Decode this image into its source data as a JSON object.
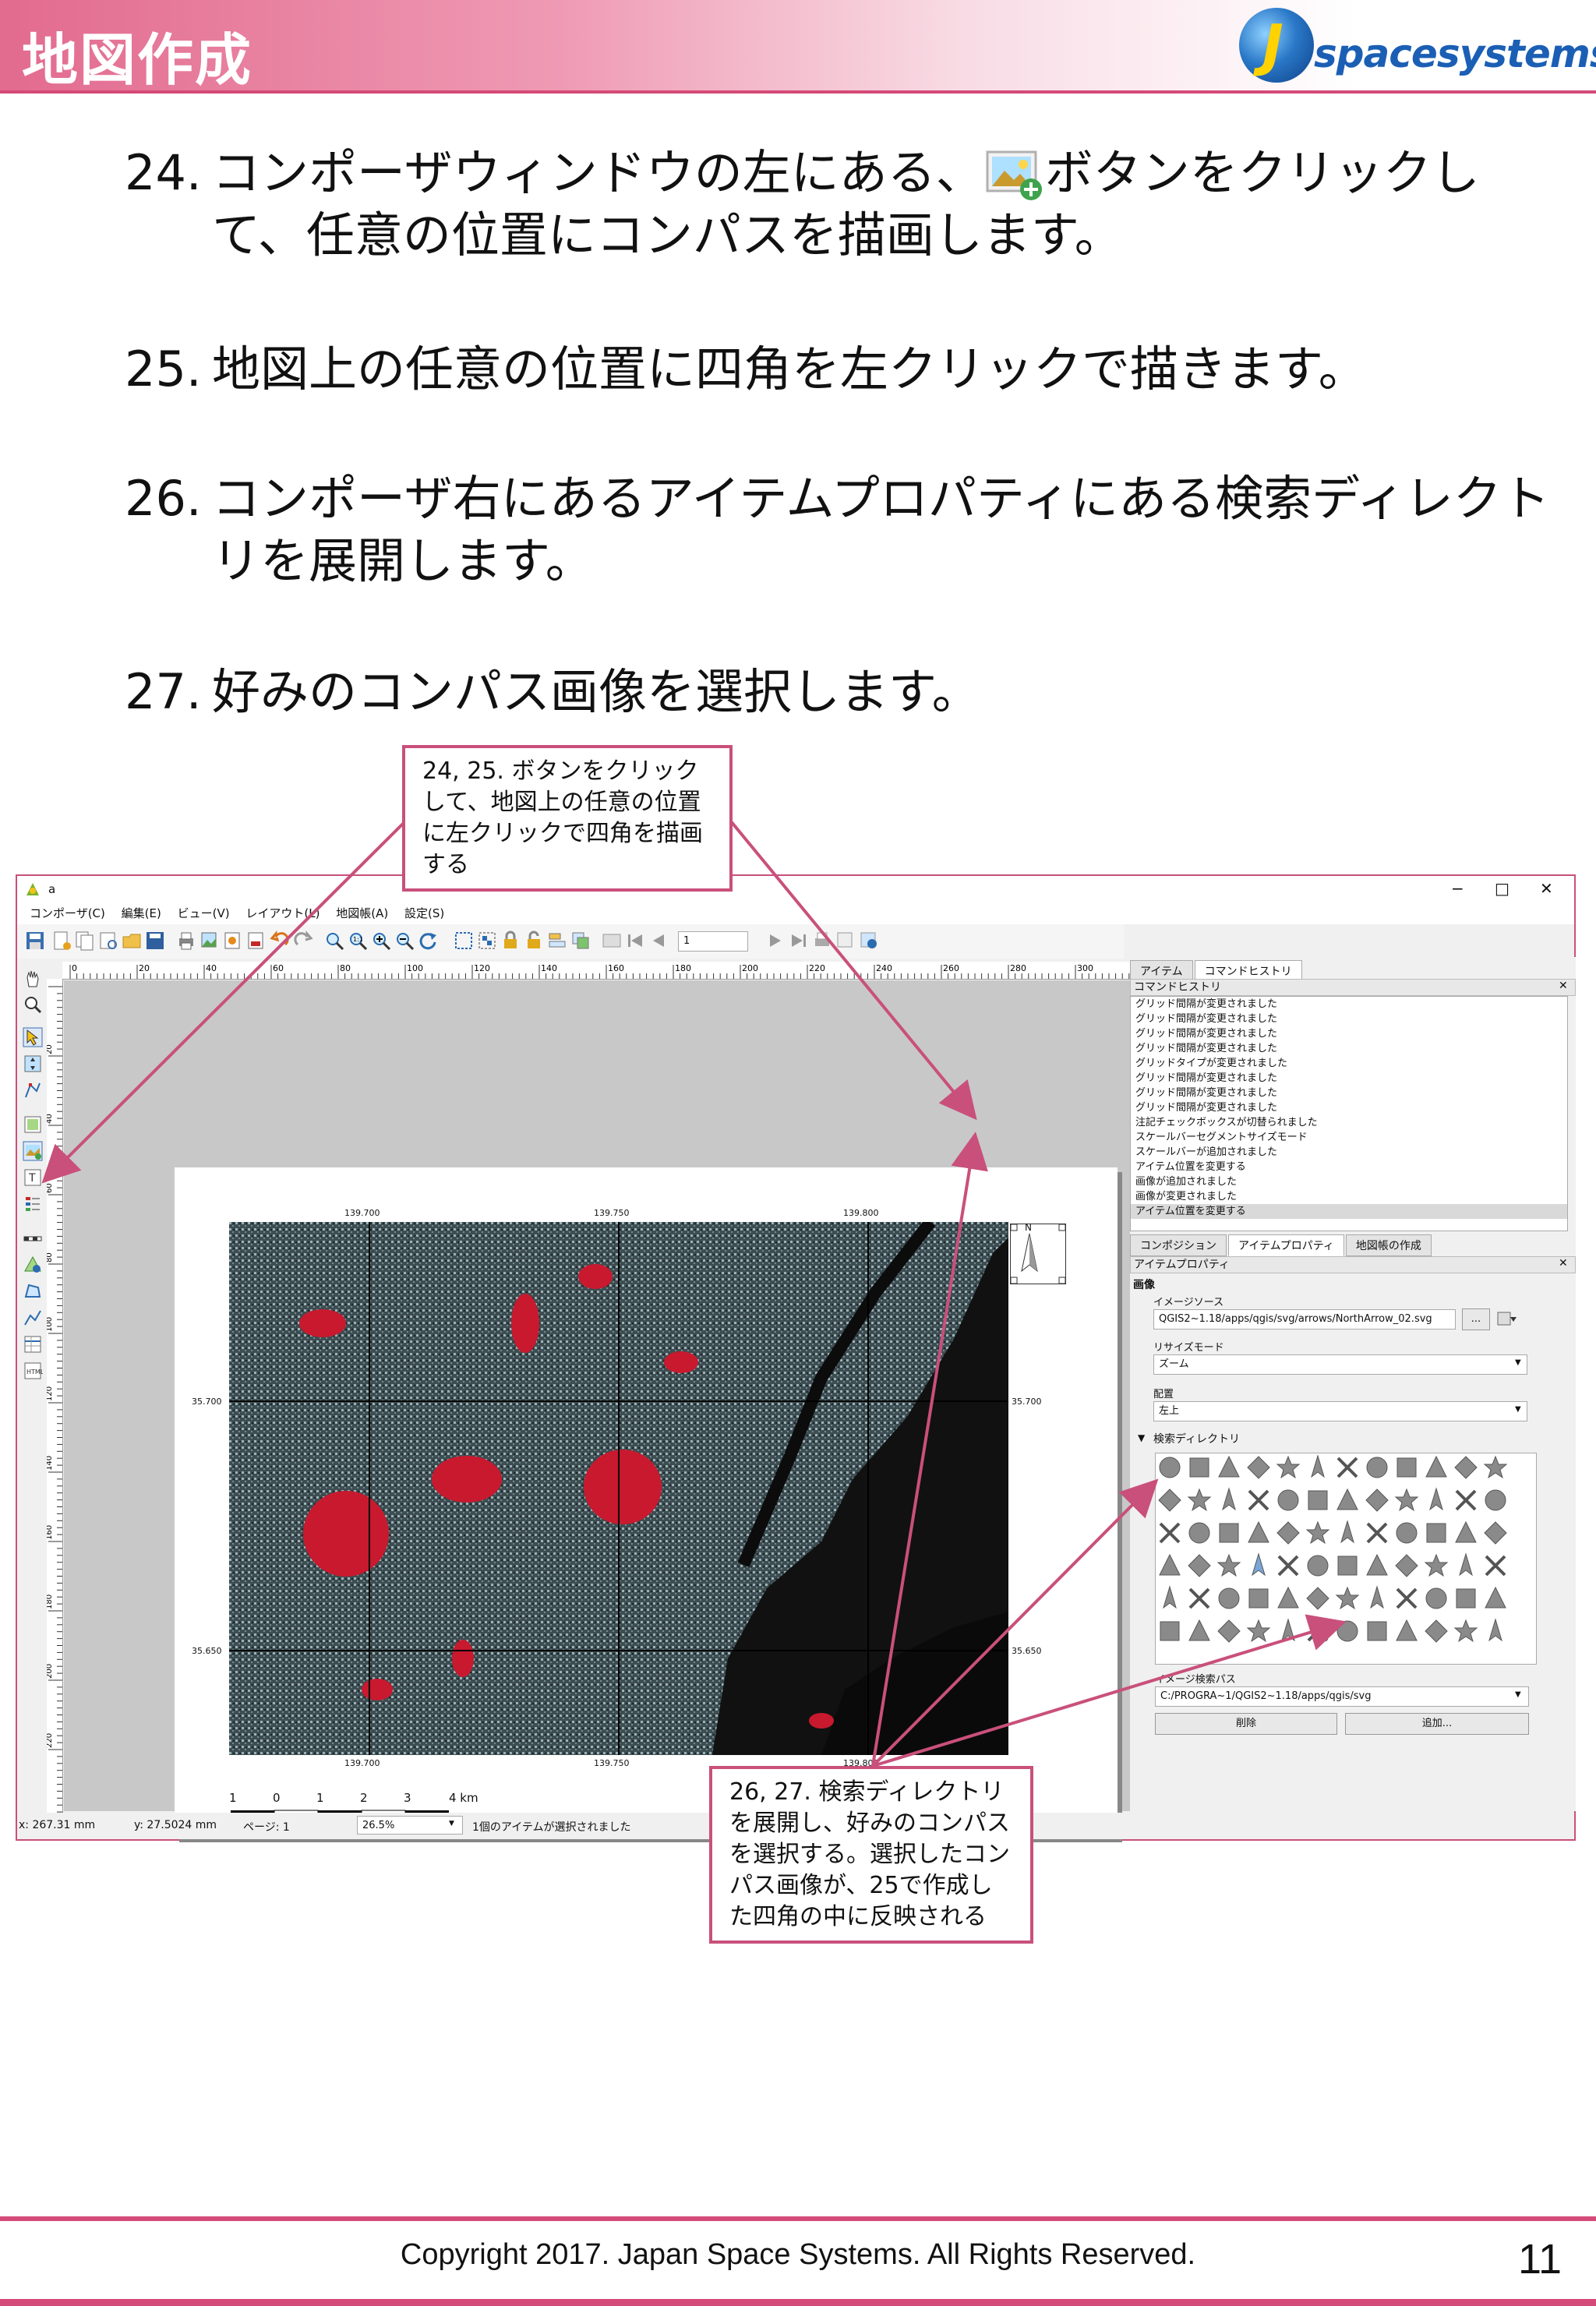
{
  "header": {
    "title": "地図作成",
    "logo_text": "spacesystems",
    "logo_letter": "J"
  },
  "steps": [
    {
      "num": "24.",
      "text_before_icon": "コンポーザウィンドウの左にある、",
      "icon": "add-image-icon",
      "text_after_icon": "ボタンをクリックして、任意の位置にコンパスを描画します。"
    },
    {
      "num": "25.",
      "text": "地図上の任意の位置に四角を左クリックで描きます。"
    },
    {
      "num": "26.",
      "text": "コンポーザ右にあるアイテムプロパティにある検索ディレクトリを展開します。"
    },
    {
      "num": "27.",
      "text": "好みのコンパス画像を選択します。"
    }
  ],
  "callouts": {
    "top": "24, 25. ボタンをクリックして、地図上の任意の位置に左クリックで四角を描画する",
    "bottom": "26, 27. 検索ディレクトリを展開し、好みのコンパスを選択する。選択したコンパス画像が、25で作成した四角の中に反映される"
  },
  "window": {
    "title": "a",
    "controls": {
      "minimize": "−",
      "maximize": "□",
      "close": "✕"
    },
    "menu": [
      "コンポーザ(C)",
      "編集(E)",
      "ビュー(V)",
      "レイアウト(L)",
      "地図帳(A)",
      "設定(S)"
    ],
    "page_field": "1",
    "ruler_h": [
      "0",
      "20",
      "40",
      "60",
      "80",
      "100",
      "120",
      "140",
      "160",
      "180",
      "200",
      "220",
      "240",
      "260",
      "280",
      "300"
    ],
    "ruler_v": [
      "20",
      "40",
      "60",
      "80",
      "100",
      "120",
      "140",
      "160",
      "180",
      "200",
      "220"
    ],
    "map": {
      "top_labels": [
        "139.700",
        "139.750",
        "139.800"
      ],
      "bottom_labels": [
        "139.700",
        "139.750",
        "139.800"
      ],
      "left_labels": [
        "35.700",
        "35.650"
      ],
      "right_labels": [
        "35.700",
        "35.650"
      ],
      "scalebar": [
        "1",
        "0",
        "1",
        "2",
        "3",
        "4 km"
      ],
      "north_label": "N"
    },
    "right_panel": {
      "top_tabs": [
        "アイテム",
        "コマンドヒストリ"
      ],
      "history_title": "コマンドヒストリ",
      "history": [
        "グリッド間隔が変更されました",
        "グリッド間隔が変更されました",
        "グリッド間隔が変更されました",
        "グリッド間隔が変更されました",
        "グリッドタイプが変更されました",
        "グリッド間隔が変更されました",
        "グリッド間隔が変更されました",
        "グリッド間隔が変更されました",
        "注記チェックボックスが切替られました",
        "スケールバーセグメントサイズモード",
        "スケールバーが追加されました",
        "アイテム位置を変更する",
        "画像が追加されました",
        "画像が変更されました",
        "アイテム位置を変更する"
      ],
      "bottom_tabs": [
        "コンポジション",
        "アイテムプロパティ",
        "地図帳の作成"
      ],
      "props_title": "アイテムプロパティ",
      "section": "画像",
      "image_source_label": "イメージソース",
      "image_source_value": "QGIS2~1.18/apps/qgis/svg/arrows/NorthArrow_02.svg",
      "browse": "...",
      "resize_label": "リサイズモード",
      "resize_value": "ズーム",
      "placement_label": "配置",
      "placement_value": "左上",
      "search_dir": "検索ディレクトリ",
      "image_search_path_label": "イメージ検索パス",
      "image_search_path": "C:/PROGRA~1/QGIS2~1.18/apps/qgis/svg",
      "delete": "削除",
      "add": "追加..."
    },
    "status": {
      "x": "x: 267.31 mm",
      "y": "y: 27.5024 mm",
      "page": "ページ: 1",
      "zoom": "26.5%",
      "msg": "1個のアイテムが選択されました"
    }
  },
  "footer": {
    "copyright": "Copyright 2017. Japan Space Systems. All Rights Reserved.",
    "page": "11"
  },
  "colors": {
    "accent": "#d44a78",
    "callout_border": "#c9507b",
    "map_red": "#d6283c"
  }
}
